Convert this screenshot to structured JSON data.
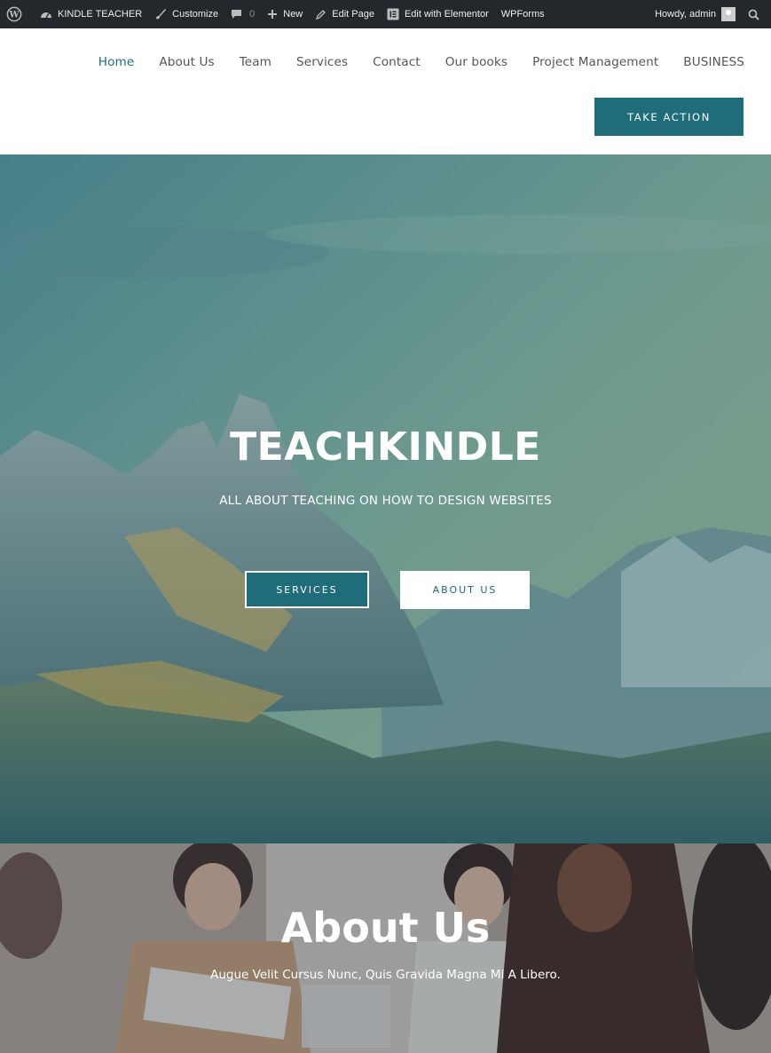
{
  "adminbar": {
    "site_name": "KINDLE TEACHER",
    "customize": "Customize",
    "comments_count": "0",
    "new": "New",
    "edit_page": "Edit Page",
    "edit_elementor": "Edit with Elementor",
    "wpforms": "WPForms",
    "howdy": "Howdy, admin"
  },
  "nav": {
    "items": [
      {
        "label": "Home",
        "active": true
      },
      {
        "label": "About Us"
      },
      {
        "label": "Team"
      },
      {
        "label": "Services"
      },
      {
        "label": "Contact"
      },
      {
        "label": "Our books"
      },
      {
        "label": "Project Management"
      },
      {
        "label": "BUSINESS"
      }
    ],
    "cta": "TAKE ACTION"
  },
  "hero": {
    "title": "TEACHKINDLE",
    "subtitle": "ALL ABOUT TEACHING ON HOW TO DESIGN WEBSITES",
    "primary_button": "SERVICES",
    "secondary_button": "ABOUT US"
  },
  "about": {
    "title": "About Us",
    "subtitle": "Augue Velit Cursus Nunc, Quis Gravida Magna Mi A Libero."
  },
  "colors": {
    "accent": "#1f6d7a",
    "adminbar": "#23282d"
  }
}
